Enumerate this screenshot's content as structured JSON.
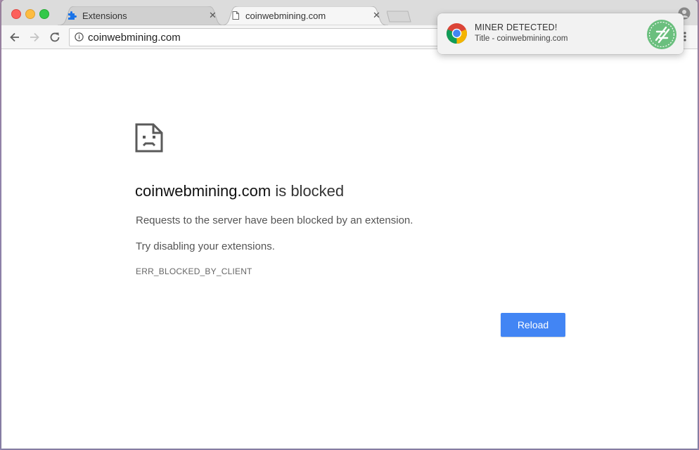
{
  "tabs": [
    {
      "title": "Extensions",
      "favicon": "puzzle-icon",
      "active": false
    },
    {
      "title": "coinwebmining.com",
      "favicon": "page-icon",
      "active": true
    }
  ],
  "tab_close_glyph": "✕",
  "omnibox": {
    "url": "coinwebmining.com"
  },
  "error_page": {
    "domain": "coinwebmining.com",
    "heading_suffix": " is blocked",
    "line1": "Requests to the server have been blocked by an extension.",
    "line2": "Try disabling your extensions.",
    "code": "ERR_BLOCKED_BY_CLIENT",
    "reload_label": "Reload"
  },
  "notification": {
    "title": "MINER DETECTED!",
    "body": "Title - coinwebmining.com"
  },
  "colors": {
    "reload_button": "#4285f4",
    "badge_green": "#6bbf7e",
    "extension_icon_blue": "#1a73e8"
  }
}
